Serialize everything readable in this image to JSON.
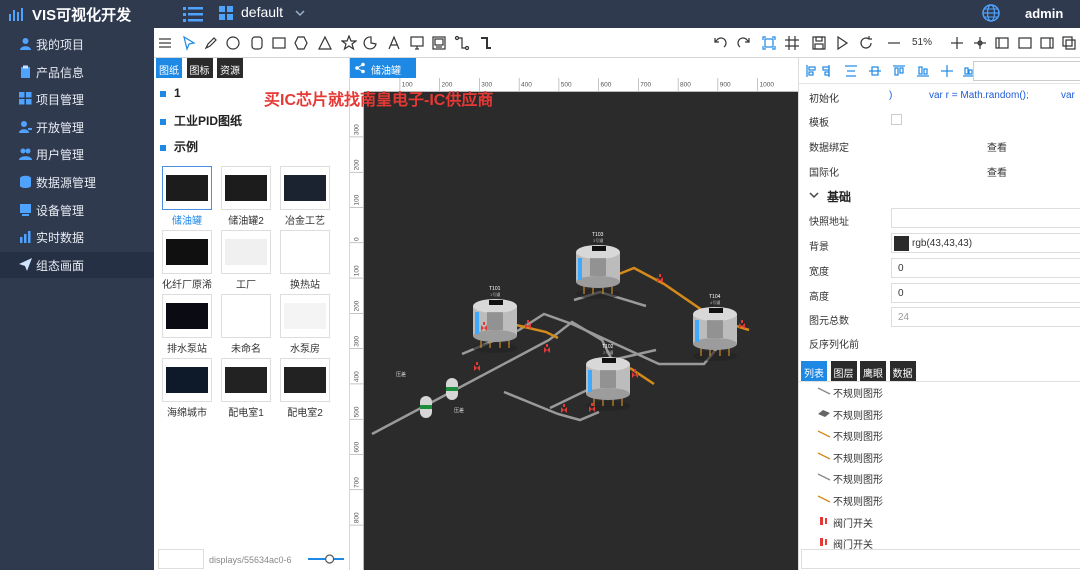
{
  "header": {
    "app_title": "VIS可视化开发",
    "project_name": "default",
    "username": "admin"
  },
  "sidebar": {
    "items": [
      {
        "label": "我的项目",
        "icon": "user-icon"
      },
      {
        "label": "产品信息",
        "icon": "clipboard-icon"
      },
      {
        "label": "项目管理",
        "icon": "grid-icon"
      },
      {
        "label": "开放管理",
        "icon": "user-key-icon"
      },
      {
        "label": "用户管理",
        "icon": "users-icon"
      },
      {
        "label": "数据源管理",
        "icon": "database-icon"
      },
      {
        "label": "设备管理",
        "icon": "device-icon"
      },
      {
        "label": "实时数据",
        "icon": "chart-icon"
      },
      {
        "label": "组态画面",
        "icon": "send-icon"
      }
    ],
    "active_index": 8
  },
  "toolbar": {
    "zoom_level": "51%",
    "icons": [
      "hamburger-icon",
      "select-icon",
      "pen-icon",
      "circle-icon",
      "rounded-rect-icon",
      "rect-icon",
      "hexagon-icon",
      "triangle-icon",
      "star-icon",
      "arc-icon",
      "text-icon",
      "monitor-icon",
      "image-icon",
      "connector-icon",
      "bend-line-icon",
      "undo-icon",
      "redo-icon",
      "frame-icon",
      "grid-icon",
      "save-icon",
      "play-icon",
      "refresh-icon",
      "zoom-out-icon",
      "zoom-in-icon",
      "move-icon",
      "panel-left-icon",
      "panel-icon",
      "panel-right-icon",
      "copy-icon"
    ]
  },
  "library": {
    "tabs": [
      "图纸",
      "图标",
      "资源"
    ],
    "active_tab": 0,
    "categories": [
      "1",
      "工业PID图纸",
      "示例"
    ],
    "thumbnails": [
      {
        "label": "储油罐",
        "selected": true
      },
      {
        "label": "储油罐2",
        "selected": false
      },
      {
        "label": "冶金工艺",
        "selected": false
      },
      {
        "label": "化纤厂原浠",
        "selected": false
      },
      {
        "label": "工厂",
        "selected": false
      },
      {
        "label": "换热站",
        "selected": false
      },
      {
        "label": "排水泵站",
        "selected": false
      },
      {
        "label": "未命名",
        "selected": false
      },
      {
        "label": "水泵房",
        "selected": false
      },
      {
        "label": "海绵城市",
        "selected": false
      },
      {
        "label": "配电室1",
        "selected": false
      },
      {
        "label": "配电室2",
        "selected": false
      }
    ],
    "display_path": "displays/55634ac0-6",
    "zoom_slider_level": 0.6
  },
  "canvas": {
    "doc_tab": "储油罐",
    "doc_tab_close": "×",
    "watermark": "买IC芯片就找南皇电子-IC供应商",
    "ruler_top": [
      "100",
      "200",
      "300",
      "400",
      "500",
      "600",
      "700",
      "800",
      "900",
      "1000"
    ],
    "ruler_left": [
      "300",
      "200",
      "100",
      "0",
      "100",
      "200",
      "300",
      "400",
      "500",
      "600",
      "700",
      "800"
    ],
    "tanks": [
      {
        "id": "T101",
        "sub": "1号罐"
      },
      {
        "id": "T103",
        "sub": "3号罐"
      },
      {
        "id": "T102",
        "sub": "2号罐"
      },
      {
        "id": "T104",
        "sub": "4号罐"
      }
    ],
    "pressure_labels": [
      "压差",
      "压差"
    ]
  },
  "props": {
    "init_label": "初始化",
    "init_code_1": "var r = Math.random();",
    "init_code_2": "var",
    "init_code_prefix": ")",
    "template_label": "模板",
    "binding_label": "数据绑定",
    "binding_action": "查看",
    "i18n_label": "国际化",
    "i18n_action": "查看",
    "section_basic": "基础",
    "snapshot_label": "快照地址",
    "snapshot_value": "",
    "background_label": "背景",
    "background_value": "rgb(43,43,43)",
    "background_color": "#2b2b2b",
    "width_label": "宽度",
    "width_value": "0",
    "height_label": "高度",
    "height_value": "0",
    "count_label": "图元总数",
    "count_value": "24",
    "deserialize_label": "反序列化前",
    "tabs": [
      "列表",
      "图层",
      "鹰眼",
      "数据"
    ],
    "active_tab": 0,
    "layers": [
      {
        "label": "不规则图形",
        "icon": "line-icon",
        "color": "#888"
      },
      {
        "label": "不规则图形",
        "icon": "shape-icon",
        "color": "#666"
      },
      {
        "label": "不规则图形",
        "icon": "line-icon",
        "color": "#d48a1b"
      },
      {
        "label": "不规则图形",
        "icon": "line-icon",
        "color": "#d48a1b"
      },
      {
        "label": "不规则图形",
        "icon": "line-icon",
        "color": "#888"
      },
      {
        "label": "不规则图形",
        "icon": "line-icon",
        "color": "#d48a1b"
      },
      {
        "label": "阀门开关",
        "icon": "valve-icon",
        "color": "#e53935"
      },
      {
        "label": "阀门开关",
        "icon": "valve-icon",
        "color": "#e53935"
      }
    ]
  },
  "colors": {
    "header_bg": "#2f3a4f",
    "accent": "#1e88e5",
    "canvas_bg": "#2b2b2b",
    "pipe_orange": "#d48a1b",
    "pipe_gray": "#9a9a9a",
    "valve_red": "#e53935"
  }
}
